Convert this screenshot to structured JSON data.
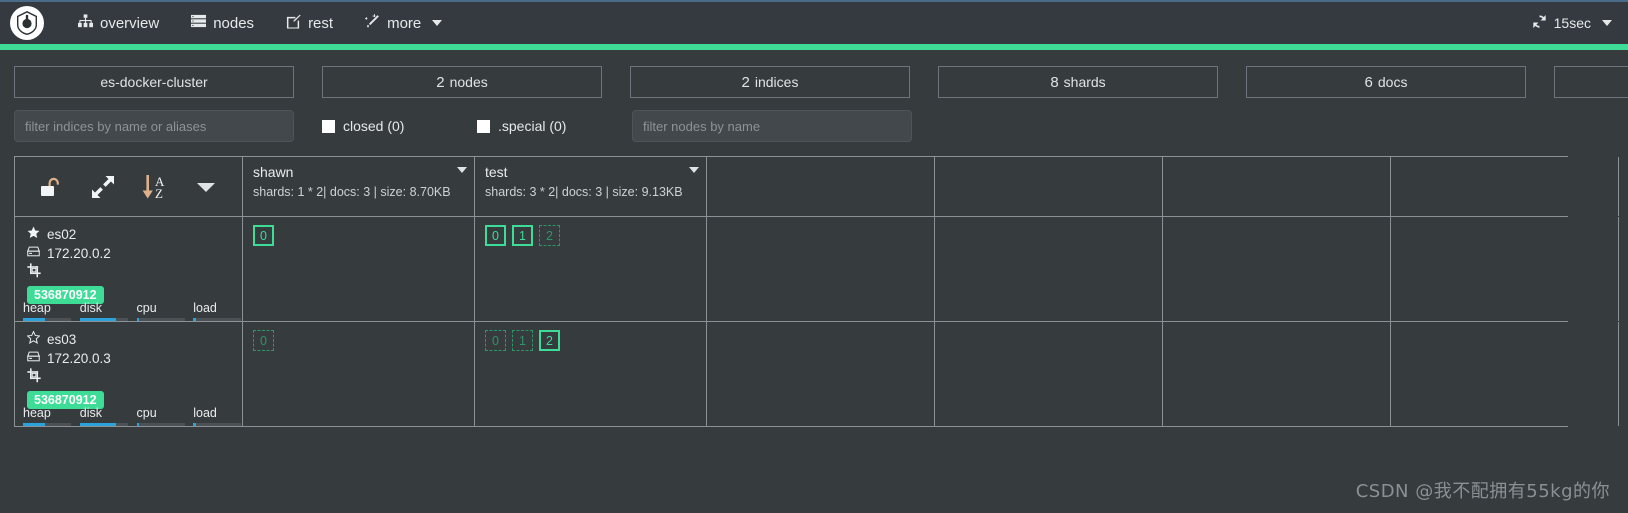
{
  "navbar": {
    "brand_icon": "cerebro-logo-icon",
    "items": [
      {
        "label": "overview",
        "icon": "sitemap-icon"
      },
      {
        "label": "nodes",
        "icon": "server-list-icon"
      },
      {
        "label": "rest",
        "icon": "edit-square-icon"
      },
      {
        "label": "more",
        "icon": "magic-wand-icon",
        "has_caret": true
      }
    ],
    "refresh": {
      "label": "15sec",
      "icon": "refresh-icon",
      "has_caret": true
    }
  },
  "accent_color": "#3ddc97",
  "stats": [
    {
      "name": "cluster-name",
      "value": "",
      "label": "es-docker-cluster"
    },
    {
      "name": "nodes-count",
      "value": "2",
      "label": "nodes"
    },
    {
      "name": "indices-count",
      "value": "2",
      "label": "indices"
    },
    {
      "name": "shards-count",
      "value": "8",
      "label": "shards"
    },
    {
      "name": "docs-count",
      "value": "6",
      "label": "docs"
    }
  ],
  "filters": {
    "indices_placeholder": "filter indices by name or aliases",
    "indices_value": "",
    "closed_label": "closed (0)",
    "special_label": ".special (0)",
    "nodes_placeholder": "filter nodes by name",
    "nodes_value": ""
  },
  "toolbar": {
    "buttons": [
      {
        "name": "unlock-icon",
        "title": "unlock"
      },
      {
        "name": "expand-icon",
        "title": "expand"
      },
      {
        "name": "sort-az-icon",
        "title": "sort a-z"
      },
      {
        "name": "chevron-down-icon",
        "title": "more"
      }
    ]
  },
  "indices": [
    {
      "name": "shawn",
      "meta": "shards: 1 * 2| docs: 3 | size: 8.70KB"
    },
    {
      "name": "test",
      "meta": "shards: 3 * 2| docs: 3 | size: 9.13KB"
    }
  ],
  "nodes": [
    {
      "name": "es02",
      "master": true,
      "star_icon": "star-filled-icon",
      "host_icon": "hard-drive-icon",
      "host": "172.20.0.2",
      "role_icon": "crop-data-icon",
      "badge": "536870912",
      "stats": [
        {
          "label": "heap",
          "pct": 45
        },
        {
          "label": "disk",
          "pct": 76
        },
        {
          "label": "cpu",
          "pct": 4
        },
        {
          "label": "load",
          "pct": 4
        }
      ],
      "shards": {
        "shawn": [
          {
            "id": "0",
            "type": "primary"
          }
        ],
        "test": [
          {
            "id": "0",
            "type": "primary"
          },
          {
            "id": "1",
            "type": "primary"
          },
          {
            "id": "2",
            "type": "replica"
          }
        ]
      }
    },
    {
      "name": "es03",
      "master": false,
      "star_icon": "star-outline-icon",
      "host_icon": "hard-drive-icon",
      "host": "172.20.0.3",
      "role_icon": "crop-data-icon",
      "badge": "536870912",
      "stats": [
        {
          "label": "heap",
          "pct": 45
        },
        {
          "label": "disk",
          "pct": 76
        },
        {
          "label": "cpu",
          "pct": 4
        },
        {
          "label": "load",
          "pct": 4
        }
      ],
      "shards": {
        "shawn": [
          {
            "id": "0",
            "type": "replica"
          }
        ],
        "test": [
          {
            "id": "0",
            "type": "replica"
          },
          {
            "id": "1",
            "type": "replica"
          },
          {
            "id": "2",
            "type": "primary"
          }
        ]
      }
    }
  ],
  "watermark": "CSDN @我不配拥有55kg的你"
}
